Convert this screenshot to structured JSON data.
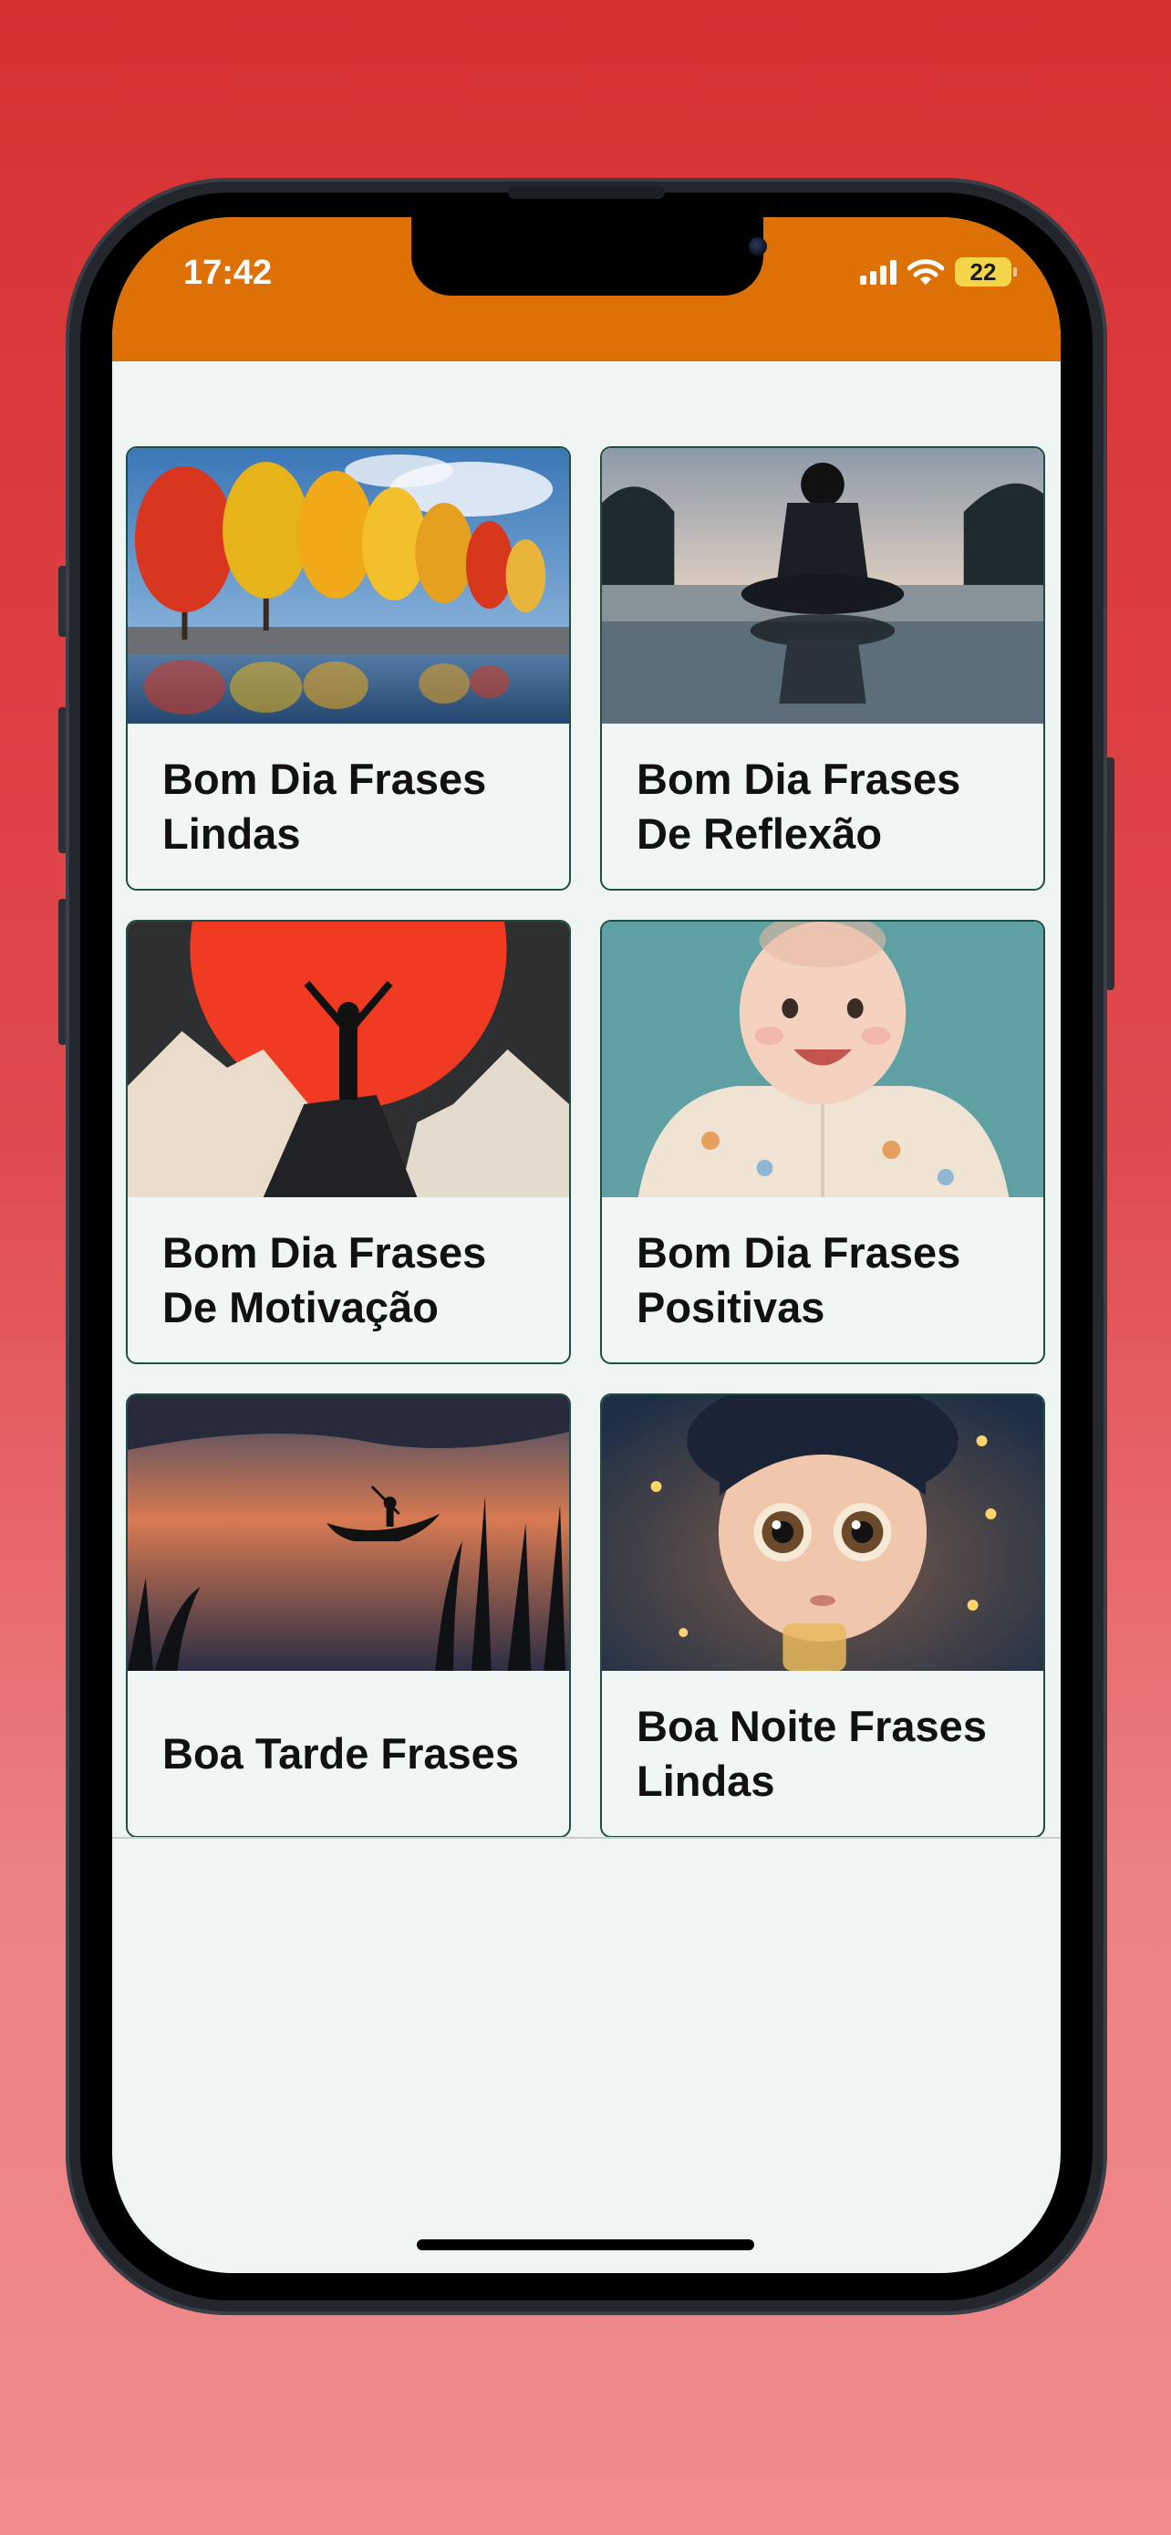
{
  "status_bar": {
    "time": "17:42",
    "battery": "22",
    "icons": [
      "cellular-signal-icon",
      "wifi-icon",
      "battery-icon"
    ],
    "background_color": "#dd7105"
  },
  "cards": [
    {
      "title": "Bom Dia Frases Lindas",
      "image": "autumn-trees-lake-image"
    },
    {
      "title": "Bom Dia Frases De Reflexão",
      "image": "meditating-person-reflection-image"
    },
    {
      "title": "Bom Dia Frases De Motivação",
      "image": "person-arms-raised-red-sun-image"
    },
    {
      "title": "Bom Dia Frases Positivas",
      "image": "smiling-baby-image"
    },
    {
      "title": "Boa Tarde Frases",
      "image": "sunset-boat-lake-image"
    },
    {
      "title": "Boa Noite Frases Lindas",
      "image": "child-fireflies-image"
    },
    {
      "title": "",
      "image": "starry-night-window-image"
    },
    {
      "title": "",
      "image": "birds-flowers-sky-image"
    }
  ],
  "colors": {
    "page_background": "#d63133",
    "card_border": "#1f4c45",
    "card_background": "#f0f6f4",
    "accent": "#dd7105"
  }
}
